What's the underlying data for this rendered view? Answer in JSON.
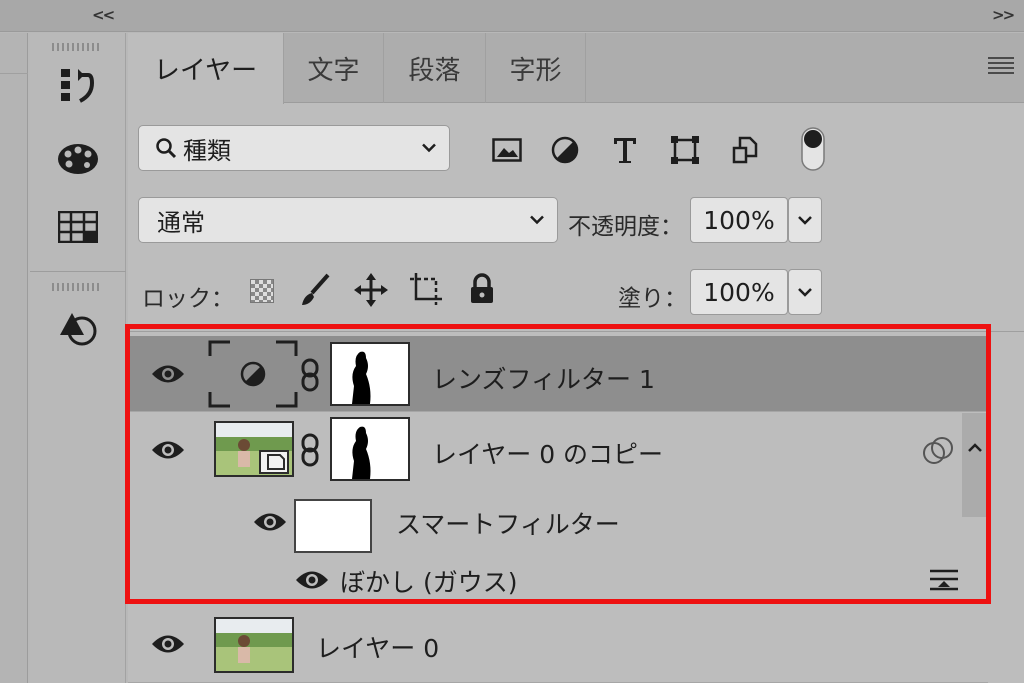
{
  "collapse_left": "<<",
  "collapse_right": ">>",
  "sidebar_icons": [
    "history-icon",
    "palette-icon",
    "grid-swatch-icon",
    "shapes-icon"
  ],
  "tabs": [
    {
      "label": "レイヤー",
      "active": true
    },
    {
      "label": "文字",
      "active": false
    },
    {
      "label": "段落",
      "active": false
    },
    {
      "label": "字形",
      "active": false
    }
  ],
  "filter": {
    "kind_label": "種類",
    "filter_icons": [
      "image-filter-icon",
      "adjustment-filter-icon",
      "type-filter-icon",
      "shape-filter-icon",
      "smart-object-filter-icon",
      "filter-toggle-icon"
    ]
  },
  "blend": {
    "mode": "通常",
    "opacity_label": "不透明度：",
    "opacity_value": "100%"
  },
  "lock": {
    "label": "ロック：",
    "fill_label": "塗り：",
    "fill_value": "100%"
  },
  "layers": [
    {
      "name": "レンズフィルター 1",
      "selected": true,
      "type": "adjustment"
    },
    {
      "name": "レイヤー 0 のコピー",
      "selected": false,
      "type": "smart-object"
    },
    {
      "name": "スマートフィルター",
      "type": "smart-filter"
    },
    {
      "name": "ぼかし (ガウス)",
      "type": "filter-effect"
    },
    {
      "name": "レイヤー 0",
      "selected": false,
      "type": "image"
    }
  ],
  "colors": {
    "highlight": "#ee1111",
    "selected_row": "#8e8e8e",
    "panel": "#bdbdbd"
  }
}
